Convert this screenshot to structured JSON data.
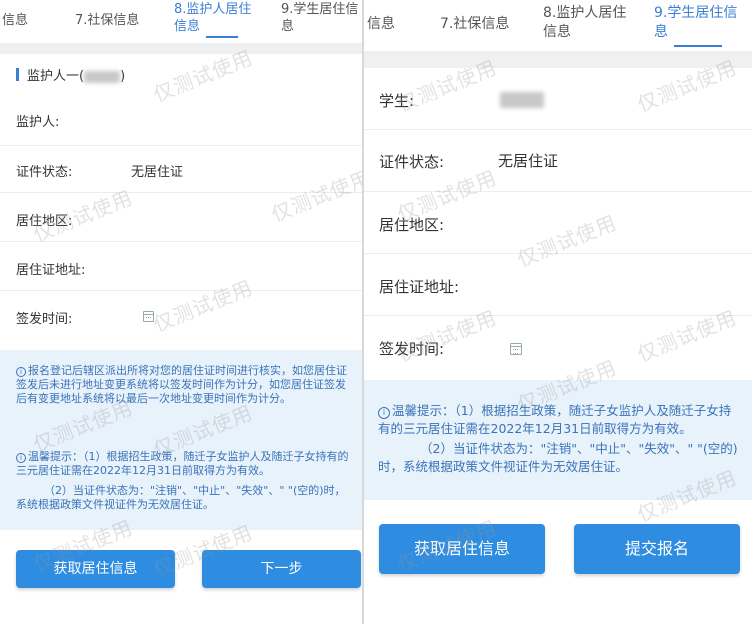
{
  "watermark": "仅测试使用",
  "left": {
    "tabs": [
      "信息",
      "7.社保信息",
      "8.监护人居住\n信息",
      "9.学生居住信\n息"
    ],
    "active_tab": 2,
    "section_title_prefix": "监护人一(",
    "section_title_suffix": ")",
    "fields": [
      {
        "label": "监护人:",
        "value": ""
      },
      {
        "label": "证件状态:",
        "value": "无居住证"
      },
      {
        "label": "居住地区:",
        "value": ""
      },
      {
        "label": "居住证地址:",
        "value": ""
      },
      {
        "label": "签发时间:",
        "value": ""
      }
    ],
    "notice": {
      "p1": "报名登记后辖区派出所将对您的居住证时间进行核实，如您居住证签发后未进行地址变更系统将以签发时间作为计分，如您居住证签发后有变更地址系统将以最后一次地址变更时间作为计分。",
      "p2": "温馨提示：（1）根据招生政策，随迁子女监护人及随迁子女持有的三元居住证需在2022年12月31日前取得方为有效。",
      "p3": "（2）当证件状态为：\"注销\"、\"中止\"、\"失效\"、\" \"(空的)时，系统根据政策文件视证件为无效居住证。"
    },
    "buttons": {
      "fetch": "获取居住信息",
      "next": "下一步"
    }
  },
  "right": {
    "tabs": [
      "信息",
      "7.社保信息",
      "8.监护人居住\n信息",
      "9.学生居住信\n息"
    ],
    "active_tab": 3,
    "fields": [
      {
        "label": "学生:",
        "value": ""
      },
      {
        "label": "证件状态:",
        "value": "无居住证"
      },
      {
        "label": "居住地区:",
        "value": ""
      },
      {
        "label": "居住证地址:",
        "value": ""
      },
      {
        "label": "签发时间:",
        "value": ""
      }
    ],
    "notice": {
      "p1": "温馨提示：（1）根据招生政策，随迁子女监护人及随迁子女持有的三元居住证需在2022年12月31日前取得方为有效。",
      "p2": "（2）当证件状态为：\"注销\"、\"中止\"、\"失效\"、\" \"(空的)时，系统根据政策文件视证件为无效居住证。"
    },
    "buttons": {
      "fetch": "获取居住信息",
      "submit": "提交报名"
    }
  },
  "colors": {
    "accent": "#3a7fd5",
    "button": "#2e8de0",
    "notice_bg": "#e8f2fb",
    "notice_text": "#3a73b8"
  }
}
